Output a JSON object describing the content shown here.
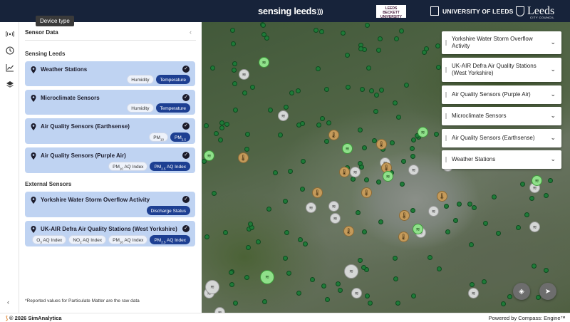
{
  "header": {
    "sensing_leeds": "sensing leeds",
    "leeds_beckett": "LEEDS BECKETT UNIVERSITY",
    "university": "UNIVERSITY OF LEEDS",
    "city_council": "Leeds",
    "city_council_sub": "CITY COUNCIL"
  },
  "tooltip": "Device type",
  "rail": {
    "items": [
      {
        "icon": "sensor-signal-icon"
      },
      {
        "icon": "clock-icon"
      },
      {
        "icon": "chart-line-icon"
      },
      {
        "icon": "layers-icon"
      }
    ],
    "collapse": "‹"
  },
  "panel": {
    "title": "Sensor Data",
    "collapse": "‹",
    "section_sensing": "Sensing Leeds",
    "section_external": "External Sensors",
    "cards": [
      {
        "title": "Weather Stations",
        "tags": [
          {
            "label": "Humidity",
            "on": false
          },
          {
            "label": "Temperature",
            "on": true
          }
        ]
      },
      {
        "title": "Microclimate Sensors",
        "tags": [
          {
            "label": "Humidity",
            "on": false
          },
          {
            "label": "Temperature",
            "on": true
          }
        ]
      },
      {
        "title": "Air Quality Sensors (Earthsense)",
        "tags": [
          {
            "base": "PM",
            "sub": "10",
            "rest": "",
            "on": false
          },
          {
            "base": "PM",
            "sub": "2.5",
            "rest": "",
            "on": true
          }
        ]
      },
      {
        "title": "Air Quality Sensors (Purple Air)",
        "tags": [
          {
            "base": "PM",
            "sub": "10",
            "rest": " AQ Index",
            "on": false
          },
          {
            "base": "PM",
            "sub": "2.5",
            "rest": " AQ Index",
            "on": true
          }
        ]
      },
      {
        "title": "Yorkshire Water Storm Overflow Activity",
        "tags": [
          {
            "label": "Discharge Status",
            "on": true
          }
        ]
      },
      {
        "title": "UK-AIR Defra Air Quality Stations (West Yorkshire)",
        "tags": [
          {
            "base": "O",
            "sub": "3",
            "rest": " AQ Index",
            "on": false
          },
          {
            "base": "NO",
            "sub": "2",
            "rest": " AQ Index",
            "on": false
          },
          {
            "base": "PM",
            "sub": "10",
            "rest": " AQ Index",
            "on": false
          },
          {
            "base": "PM",
            "sub": "2.5",
            "rest": " AQ Index",
            "on": true
          }
        ]
      }
    ],
    "footnote": "*Reported values for Particulate Matter are the raw data"
  },
  "map": {
    "layers": [
      "Yorkshire Water Storm Overflow Activity",
      "UK-AIR Defra Air Quality Stations (West Yorkshire)",
      "Air Quality Sensors (Purple Air)",
      "Microclimate Sensors",
      "Air Quality Sensors (Earthsense)",
      "Weather Stations"
    ],
    "layers_button": "◈",
    "locate_button": "➤"
  },
  "footer": {
    "copyright": "© 2026 SimAnalytica",
    "powered": "Powered by Compass: Engine™"
  },
  "colors": {
    "header_bg": "#17233a",
    "card_bg": "#bfd3f2",
    "tag_active": "#1d3f92",
    "brand_orange": "#e07a1d"
  }
}
